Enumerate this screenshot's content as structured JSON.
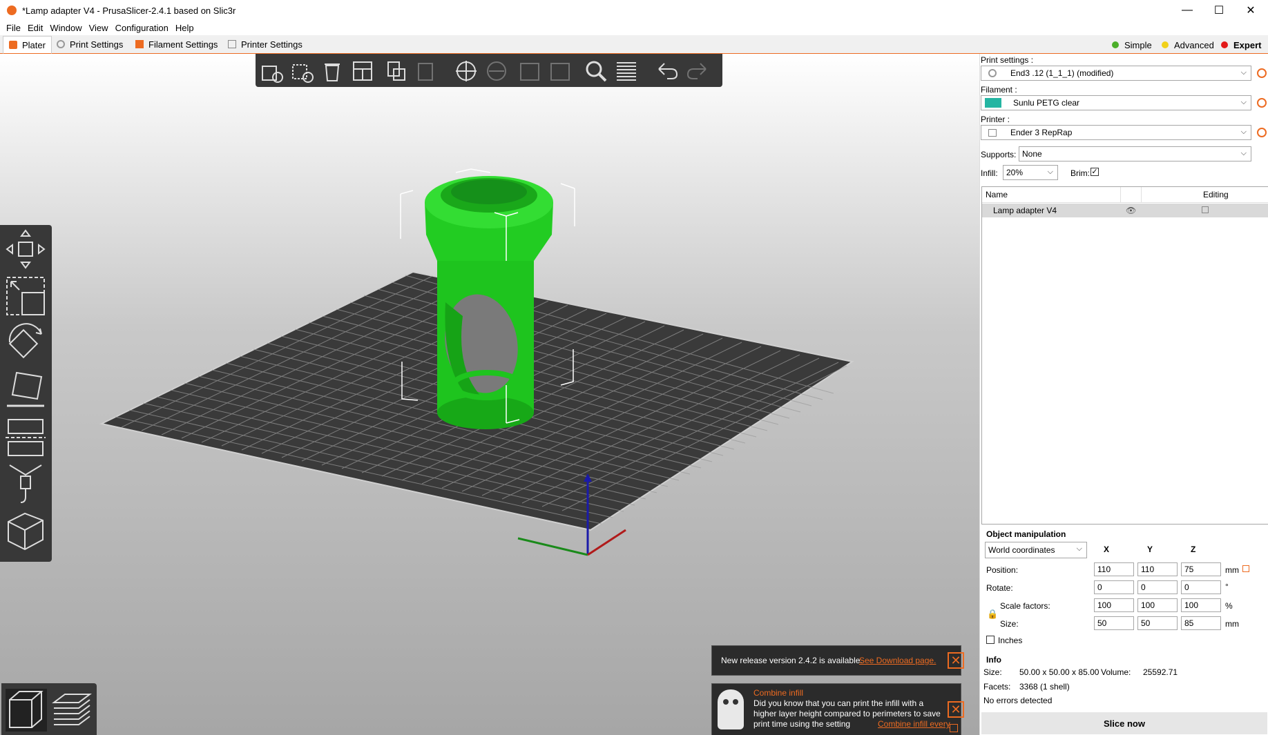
{
  "window": {
    "title": "*Lamp adapter V4 - PrusaSlicer-2.4.1 based on Slic3r"
  },
  "menu": [
    "File",
    "Edit",
    "Window",
    "View",
    "Configuration",
    "Help"
  ],
  "tabs": [
    "Plater",
    "Print Settings",
    "Filament Settings",
    "Printer Settings"
  ],
  "modes": [
    {
      "label": "Simple",
      "color": "#4caf2a"
    },
    {
      "label": "Advanced",
      "color": "#f1d11a"
    },
    {
      "label": "Expert",
      "color": "#e31b1b"
    }
  ],
  "toolbar_icons": [
    "add-icon",
    "delete-icon",
    "delete-all-icon",
    "arrange-icon",
    "copy-icon",
    "paste-icon",
    "add-instance-icon",
    "remove-instance-icon",
    "split-objects-icon",
    "split-parts-icon",
    "search-icon",
    "layers-editing-icon",
    "undo-icon",
    "redo-icon"
  ],
  "gizmos": [
    "move-icon",
    "scale-icon",
    "rotate-icon",
    "place-on-face-icon",
    "cut-icon",
    "support-paint-icon",
    "seam-paint-icon"
  ],
  "views": [
    "3d-view-icon",
    "preview-icon"
  ],
  "sidebar": {
    "print_settings_label": "Print settings :",
    "print_settings_value": "End3 .12 (1_1_1) (modified)",
    "filament_label": "Filament :",
    "filament_value": "Sunlu PETG clear",
    "filament_color": "#24b5a2",
    "printer_label": "Printer :",
    "printer_value": "Ender 3 RepRap",
    "supports_label": "Supports:",
    "supports_value": "None",
    "infill_label": "Infill:",
    "infill_value": "20%",
    "brim_label": "Brim:",
    "brim_checked": true,
    "list_header_name": "Name",
    "list_header_editing": "Editing",
    "object_name": "Lamp adapter V4"
  },
  "object_manipulation": {
    "title": "Object manipulation",
    "coordinates": "World coordinates",
    "axes": [
      "X",
      "Y",
      "Z"
    ],
    "position_label": "Position:",
    "position": [
      "110",
      "110",
      "75"
    ],
    "position_unit": "mm",
    "rotate_label": "Rotate:",
    "rotate": [
      "0",
      "0",
      "0"
    ],
    "rotate_unit": "°",
    "scale_label": "Scale factors:",
    "scale": [
      "100",
      "100",
      "100"
    ],
    "scale_unit": "%",
    "size_label": "Size:",
    "size": [
      "50",
      "50",
      "85"
    ],
    "size_unit": "mm",
    "inches_label": "Inches"
  },
  "info": {
    "title": "Info",
    "size_label": "Size:",
    "size_value": "50.00 x 50.00 x 85.00",
    "volume_label": "Volume:",
    "volume_value": "25592.71",
    "facets_label": "Facets:",
    "facets_value": "3368 (1 shell)",
    "errors": "No errors detected"
  },
  "slice_button": "Slice now",
  "notifications": {
    "release_text": "New release version 2.4.2 is available.",
    "release_link": "See Download page.",
    "hint_title": "Combine infill",
    "hint_line1": "Did you know that you can print the infill with a",
    "hint_line2": "higher layer height compared to perimeters to save",
    "hint_line3": "print time using the setting",
    "hint_link": "Combine infill every"
  }
}
